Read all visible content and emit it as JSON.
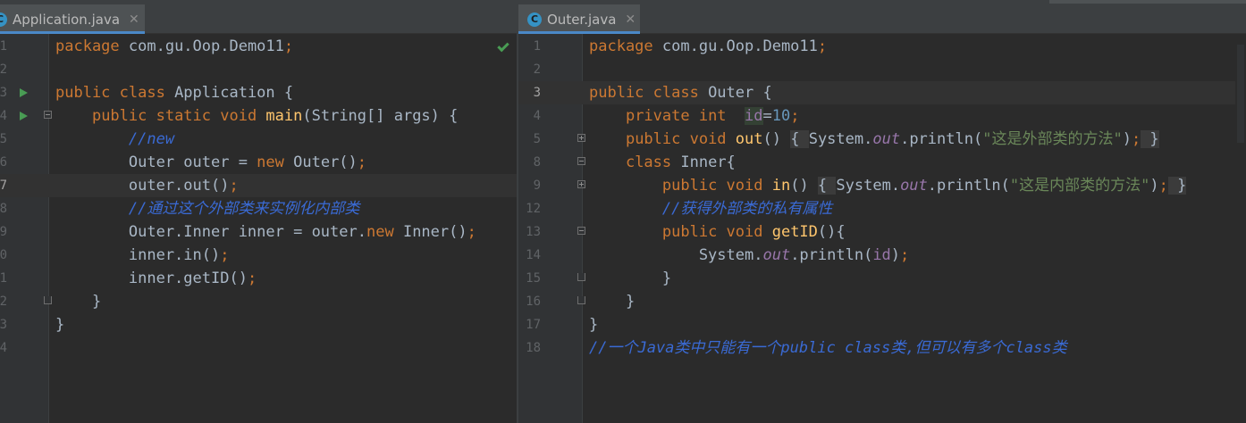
{
  "colors": {
    "background": "#2b2b2b",
    "gutter": "#313335",
    "keyword": "#cc7832",
    "method": "#ffc66d",
    "string": "#6a8759",
    "number": "#6897bb",
    "comment": "#3a6ad4",
    "field": "#9876aa",
    "default_text": "#a9b7c6",
    "tab_accent": "#4a88c7"
  },
  "left": {
    "tab": {
      "icon": "java-class-run-icon",
      "icon_letter": "C",
      "title": "Application.java",
      "close": "✕"
    },
    "status_icon": "inspection-ok-checkmark-icon",
    "lines": [
      {
        "num": "1",
        "tokens": [
          [
            "kw",
            "package"
          ],
          [
            "t",
            " com.gu.Oop.Demo11"
          ],
          [
            "kw",
            ";"
          ]
        ]
      },
      {
        "num": "2",
        "tokens": []
      },
      {
        "num": "3",
        "run": true,
        "tokens": [
          [
            "kw",
            "public class "
          ],
          [
            "t",
            "Application {"
          ]
        ]
      },
      {
        "num": "4",
        "run": true,
        "fold": "start",
        "tokens": [
          [
            "t",
            "    "
          ],
          [
            "kw",
            "public static void "
          ],
          [
            "fn",
            "main"
          ],
          [
            "t",
            "(String[] args) {"
          ]
        ]
      },
      {
        "num": "5",
        "tokens": [
          [
            "t",
            "        "
          ],
          [
            "cmt",
            "//new"
          ]
        ]
      },
      {
        "num": "6",
        "tokens": [
          [
            "t",
            "        Outer outer = "
          ],
          [
            "kw",
            "new "
          ],
          [
            "t",
            "Outer()"
          ],
          [
            "kw",
            ";"
          ]
        ]
      },
      {
        "num": "7",
        "current": true,
        "tokens": [
          [
            "t",
            "        outer.out()"
          ],
          [
            "kw",
            ";"
          ]
        ]
      },
      {
        "num": "8",
        "tokens": [
          [
            "t",
            "        "
          ],
          [
            "cmt",
            "//通过这个外部类来实例化内部类"
          ]
        ]
      },
      {
        "num": "9",
        "tokens": [
          [
            "t",
            "        Outer.Inner inner = outer."
          ],
          [
            "kw",
            "new "
          ],
          [
            "t",
            "Inner()"
          ],
          [
            "kw",
            ";"
          ]
        ]
      },
      {
        "num": "0",
        "tokens": [
          [
            "t",
            "        inner.in()"
          ],
          [
            "kw",
            ";"
          ]
        ]
      },
      {
        "num": "1",
        "tokens": [
          [
            "t",
            "        inner.getID()"
          ],
          [
            "kw",
            ";"
          ]
        ]
      },
      {
        "num": "2",
        "fold": "end",
        "tokens": [
          [
            "t",
            "    }"
          ]
        ]
      },
      {
        "num": "3",
        "tokens": [
          [
            "t",
            "}"
          ]
        ]
      },
      {
        "num": "4",
        "tokens": []
      }
    ]
  },
  "right": {
    "tab": {
      "icon": "java-class-icon",
      "icon_letter": "C",
      "title": "Outer.java",
      "close": "✕"
    },
    "lines": [
      {
        "num": "1",
        "tokens": [
          [
            "kw",
            "package"
          ],
          [
            "t",
            " com.gu.Oop.Demo11"
          ],
          [
            "kw",
            ";"
          ]
        ]
      },
      {
        "num": "2",
        "tokens": []
      },
      {
        "num": "3",
        "current": true,
        "tokens": [
          [
            "kw",
            "public class "
          ],
          [
            "t",
            "Outer {"
          ]
        ]
      },
      {
        "num": "4",
        "tokens": [
          [
            "t",
            "    "
          ],
          [
            "kw",
            "private int  "
          ],
          [
            "fieldhl",
            "id"
          ],
          [
            "t",
            "="
          ],
          [
            "num",
            "10"
          ],
          [
            "kw",
            ";"
          ]
        ]
      },
      {
        "num": "5",
        "fold": "plus",
        "tokens": [
          [
            "t",
            "    "
          ],
          [
            "kw",
            "public void "
          ],
          [
            "fn",
            "out"
          ],
          [
            "t",
            "() "
          ],
          [
            "fb",
            "{ "
          ],
          [
            "t",
            "System."
          ],
          [
            "sf",
            "out"
          ],
          [
            "t",
            ".println("
          ],
          [
            "str",
            "\"这是外部类的方法\""
          ],
          [
            "t",
            ")"
          ],
          [
            "kw",
            ";"
          ],
          [
            "fb",
            " }"
          ]
        ]
      },
      {
        "num": "8",
        "fold": "start",
        "tokens": [
          [
            "t",
            "    "
          ],
          [
            "kw",
            "class "
          ],
          [
            "t",
            "Inner{"
          ]
        ]
      },
      {
        "num": "9",
        "fold": "plus",
        "tokens": [
          [
            "t",
            "        "
          ],
          [
            "kw",
            "public void "
          ],
          [
            "fn",
            "in"
          ],
          [
            "t",
            "() "
          ],
          [
            "fb",
            "{ "
          ],
          [
            "t",
            "System."
          ],
          [
            "sf",
            "out"
          ],
          [
            "t",
            ".println("
          ],
          [
            "str",
            "\"这是内部类的方法\""
          ],
          [
            "t",
            ")"
          ],
          [
            "kw",
            ";"
          ],
          [
            "fb",
            " }"
          ]
        ]
      },
      {
        "num": "12",
        "tokens": [
          [
            "t",
            "        "
          ],
          [
            "cmt",
            "//获得外部类的私有属性"
          ]
        ]
      },
      {
        "num": "13",
        "fold": "start",
        "tokens": [
          [
            "t",
            "        "
          ],
          [
            "kw",
            "public void "
          ],
          [
            "fn",
            "getID"
          ],
          [
            "t",
            "(){"
          ]
        ]
      },
      {
        "num": "14",
        "tokens": [
          [
            "t",
            "            System."
          ],
          [
            "sf",
            "out"
          ],
          [
            "t",
            ".println("
          ],
          [
            "f",
            "id"
          ],
          [
            "t",
            ")"
          ],
          [
            "kw",
            ";"
          ]
        ]
      },
      {
        "num": "15",
        "fold": "end",
        "tokens": [
          [
            "t",
            "        }"
          ]
        ]
      },
      {
        "num": "16",
        "fold": "end",
        "tokens": [
          [
            "t",
            "    }"
          ]
        ]
      },
      {
        "num": "17",
        "tokens": [
          [
            "t",
            "}"
          ]
        ]
      },
      {
        "num": "18",
        "tokens": [
          [
            "cmt",
            "//一个Java类中只能有一个public class类,但可以有多个class类"
          ]
        ]
      }
    ]
  }
}
